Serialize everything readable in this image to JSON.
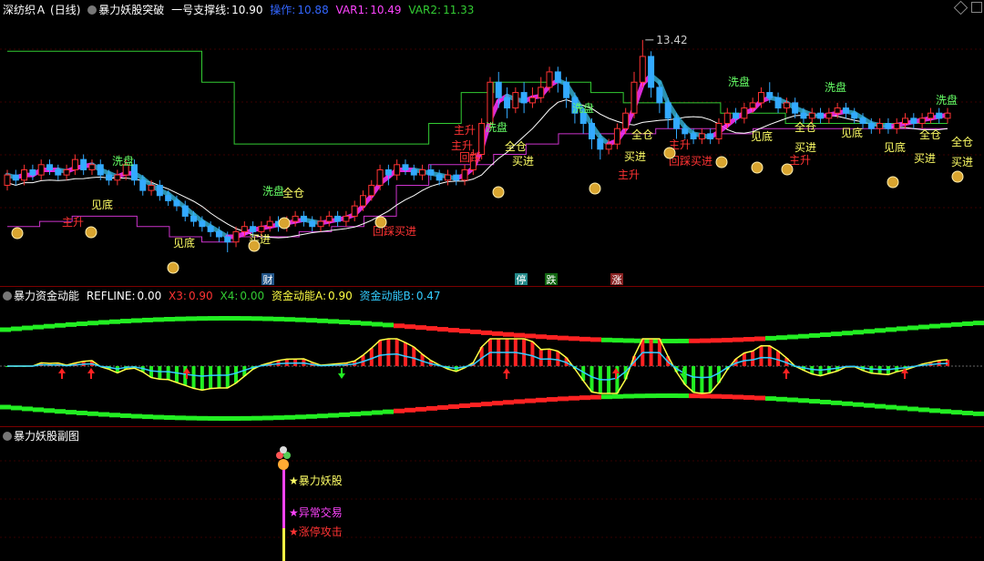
{
  "panel1": {
    "stock_name": "深纺织Ａ",
    "period": "(日线)",
    "indicator_name": "暴力妖股突破",
    "support_label": "一号支撑线:",
    "support_value": "10.90",
    "op_label": "操作:",
    "op_value": "10.88",
    "var1_label": "VAR1:",
    "var1_value": "10.49",
    "var2_label": "VAR2:",
    "var2_value": "11.33",
    "high_marker": "13.42",
    "colors": {
      "up": "#ff3333",
      "down": "#33aaff",
      "support": "#33cc33",
      "ma": "#ffffff",
      "var1": "#cc33cc",
      "ribbon_up": "#ff33ff",
      "ribbon_dn": "#33aacc"
    },
    "signals": [
      {
        "text": "洗盘",
        "color": "#66ff66"
      },
      {
        "text": "见底",
        "color": "#ffff66"
      },
      {
        "text": "主升",
        "color": "#ff3333"
      },
      {
        "text": "见底",
        "color": "#ffff66"
      },
      {
        "text": "买进",
        "color": "#ffff66"
      },
      {
        "text": "洗盘",
        "color": "#66ff66"
      },
      {
        "text": "全仓",
        "color": "#ffff66"
      },
      {
        "text": "主升",
        "color": "#ff3333"
      },
      {
        "text": "回踩买进",
        "color": "#ff3333"
      },
      {
        "text": "主升",
        "color": "#ff3333"
      },
      {
        "text": "回踩",
        "color": "#ff3333"
      },
      {
        "text": "洗盘",
        "color": "#66ff66"
      },
      {
        "text": "全仓",
        "color": "#ffff66"
      },
      {
        "text": "买进",
        "color": "#ffff66"
      },
      {
        "text": "洗盘",
        "color": "#66ff66"
      },
      {
        "text": "全仓",
        "color": "#ffff66"
      },
      {
        "text": "买进",
        "color": "#ffff66"
      },
      {
        "text": "主升",
        "color": "#ff3333"
      },
      {
        "text": "主升",
        "color": "#ff3333"
      },
      {
        "text": "回踩买进",
        "color": "#ff3333"
      },
      {
        "text": "洗盘",
        "color": "#66ff66"
      },
      {
        "text": "见底",
        "color": "#ffff66"
      },
      {
        "text": "全仓",
        "color": "#ffff66"
      },
      {
        "text": "买进",
        "color": "#ffff66"
      },
      {
        "text": "主升",
        "color": "#ff3333"
      },
      {
        "text": "洗盘",
        "color": "#66ff66"
      },
      {
        "text": "见底",
        "color": "#ffff66"
      },
      {
        "text": "见底",
        "color": "#ffff66"
      },
      {
        "text": "买进",
        "color": "#ffff66"
      },
      {
        "text": "洗盘",
        "color": "#66ff66"
      },
      {
        "text": "全仓",
        "color": "#ffff66"
      },
      {
        "text": "全仓",
        "color": "#ffff66"
      },
      {
        "text": "买进",
        "color": "#ffff66"
      }
    ],
    "bottom_tags": [
      {
        "text": "财",
        "bg": "#225588",
        "fg": "#ffffff"
      },
      {
        "text": "停",
        "bg": "#228888",
        "fg": "#ffffff"
      },
      {
        "text": "跌",
        "bg": "#116611",
        "fg": "#ffffff"
      },
      {
        "text": "涨",
        "bg": "#882222",
        "fg": "#ffffff"
      }
    ]
  },
  "panel2": {
    "indicator_name": "暴力资金动能",
    "refline_label": "REFLINE:",
    "refline_value": "0.00",
    "x3_label": "X3:",
    "x3_value": "0.90",
    "x4_label": "X4:",
    "x4_value": "0.00",
    "a_label": "资金动能A:",
    "a_value": "0.90",
    "b_label": "资金动能B:",
    "b_value": "0.47"
  },
  "panel3": {
    "indicator_name": "暴力妖股副图",
    "labels": [
      {
        "text": "暴力妖股",
        "color": "#ffff66"
      },
      {
        "text": "异常交易",
        "color": "#ff44ff"
      },
      {
        "text": "涨停攻击",
        "color": "#ff3333"
      }
    ]
  },
  "chart_data": {
    "type": "candlestick",
    "title": "暴力妖股突破",
    "candles": [
      [
        10.6,
        10.8,
        10.9,
        10.5
      ],
      [
        10.8,
        10.7,
        10.9,
        10.6
      ],
      [
        10.7,
        10.9,
        11.0,
        10.6
      ],
      [
        10.9,
        10.8,
        11.0,
        10.7
      ],
      [
        10.8,
        11.0,
        11.1,
        10.7
      ],
      [
        11.0,
        10.9,
        11.1,
        10.8
      ],
      [
        10.9,
        10.8,
        11.0,
        10.7
      ],
      [
        10.8,
        10.9,
        11.0,
        10.7
      ],
      [
        10.9,
        11.1,
        11.2,
        10.8
      ],
      [
        11.1,
        10.9,
        11.2,
        10.8
      ],
      [
        10.9,
        11.0,
        11.1,
        10.8
      ],
      [
        11.0,
        10.8,
        11.1,
        10.7
      ],
      [
        10.8,
        10.7,
        10.9,
        10.6
      ],
      [
        10.7,
        10.8,
        10.9,
        10.6
      ],
      [
        10.8,
        11.0,
        11.1,
        10.7
      ],
      [
        11.0,
        10.7,
        11.1,
        10.6
      ],
      [
        10.7,
        10.5,
        10.8,
        10.4
      ],
      [
        10.5,
        10.6,
        10.7,
        10.4
      ],
      [
        10.6,
        10.4,
        10.7,
        10.3
      ],
      [
        10.4,
        10.3,
        10.5,
        10.2
      ],
      [
        10.3,
        10.2,
        10.4,
        10.1
      ],
      [
        10.2,
        10.0,
        10.3,
        9.9
      ],
      [
        10.0,
        9.9,
        10.1,
        9.8
      ],
      [
        9.9,
        9.8,
        10.0,
        9.7
      ],
      [
        9.8,
        9.7,
        9.9,
        9.6
      ],
      [
        9.7,
        9.6,
        9.8,
        9.5
      ],
      [
        9.6,
        9.5,
        9.7,
        9.3
      ],
      [
        9.5,
        9.7,
        9.8,
        9.4
      ],
      [
        9.7,
        9.8,
        9.9,
        9.6
      ],
      [
        9.8,
        9.7,
        9.9,
        9.6
      ],
      [
        9.7,
        9.8,
        9.9,
        9.6
      ],
      [
        9.8,
        9.9,
        10.0,
        9.7
      ],
      [
        9.9,
        9.8,
        10.0,
        9.7
      ],
      [
        9.8,
        9.9,
        10.0,
        9.7
      ],
      [
        9.9,
        10.0,
        10.1,
        9.8
      ],
      [
        10.0,
        9.9,
        10.1,
        9.8
      ],
      [
        9.9,
        9.8,
        10.0,
        9.7
      ],
      [
        9.8,
        9.9,
        10.0,
        9.7
      ],
      [
        9.9,
        10.0,
        10.1,
        9.8
      ],
      [
        10.0,
        9.9,
        10.1,
        9.8
      ],
      [
        9.9,
        10.0,
        10.1,
        9.8
      ],
      [
        10.0,
        10.2,
        10.3,
        9.9
      ],
      [
        10.2,
        10.4,
        10.5,
        10.1
      ],
      [
        10.4,
        10.6,
        10.7,
        10.3
      ],
      [
        10.6,
        10.9,
        11.0,
        10.5
      ],
      [
        10.9,
        10.8,
        11.0,
        10.6
      ],
      [
        10.8,
        11.0,
        11.1,
        10.7
      ],
      [
        11.0,
        10.9,
        11.1,
        10.8
      ],
      [
        10.9,
        10.8,
        11.0,
        10.7
      ],
      [
        10.8,
        10.9,
        11.0,
        10.7
      ],
      [
        10.9,
        10.8,
        11.0,
        10.7
      ],
      [
        10.8,
        10.7,
        10.9,
        10.6
      ],
      [
        10.7,
        10.8,
        10.9,
        10.6
      ],
      [
        10.8,
        10.7,
        10.9,
        10.6
      ],
      [
        10.7,
        10.9,
        11.0,
        10.6
      ],
      [
        10.9,
        11.2,
        11.3,
        10.8
      ],
      [
        11.2,
        11.8,
        11.9,
        11.1
      ],
      [
        11.8,
        12.6,
        12.7,
        11.7
      ],
      [
        12.6,
        12.3,
        12.8,
        12.1
      ],
      [
        12.3,
        12.1,
        12.5,
        11.9
      ],
      [
        12.1,
        12.4,
        12.5,
        12.0
      ],
      [
        12.4,
        12.2,
        12.6,
        12.0
      ],
      [
        12.2,
        12.3,
        12.5,
        12.1
      ],
      [
        12.3,
        12.5,
        12.7,
        12.2
      ],
      [
        12.5,
        12.8,
        12.9,
        12.4
      ],
      [
        12.8,
        12.6,
        12.9,
        12.4
      ],
      [
        12.6,
        12.3,
        12.7,
        12.1
      ],
      [
        12.3,
        12.0,
        12.4,
        11.8
      ],
      [
        12.0,
        11.8,
        12.1,
        11.6
      ],
      [
        11.8,
        11.5,
        11.9,
        11.3
      ],
      [
        11.5,
        11.3,
        11.6,
        11.1
      ],
      [
        11.3,
        11.4,
        11.5,
        11.2
      ],
      [
        11.4,
        11.7,
        11.8,
        11.3
      ],
      [
        11.7,
        12.0,
        12.1,
        11.6
      ],
      [
        12.0,
        12.6,
        12.8,
        11.9
      ],
      [
        12.6,
        13.1,
        13.42,
        12.5
      ],
      [
        13.1,
        12.5,
        13.2,
        12.3
      ],
      [
        12.5,
        12.2,
        12.6,
        12.0
      ],
      [
        12.2,
        11.9,
        12.3,
        11.7
      ],
      [
        11.9,
        11.7,
        12.0,
        11.5
      ],
      [
        11.7,
        11.6,
        11.8,
        11.5
      ],
      [
        11.6,
        11.5,
        11.7,
        11.4
      ],
      [
        11.5,
        11.6,
        11.7,
        11.4
      ],
      [
        11.6,
        11.5,
        11.7,
        11.4
      ],
      [
        11.5,
        11.8,
        11.9,
        11.4
      ],
      [
        11.8,
        12.0,
        12.1,
        11.7
      ],
      [
        12.0,
        11.9,
        12.1,
        11.8
      ],
      [
        11.9,
        12.1,
        12.2,
        11.8
      ],
      [
        12.1,
        12.2,
        12.3,
        12.0
      ],
      [
        12.2,
        12.4,
        12.5,
        12.1
      ],
      [
        12.4,
        12.3,
        12.6,
        12.2
      ],
      [
        12.3,
        12.1,
        12.4,
        12.0
      ],
      [
        12.1,
        12.2,
        12.3,
        12.0
      ],
      [
        12.2,
        12.0,
        12.3,
        11.9
      ],
      [
        12.0,
        11.9,
        12.1,
        11.8
      ],
      [
        11.9,
        12.0,
        12.1,
        11.8
      ],
      [
        12.0,
        11.9,
        12.1,
        11.8
      ],
      [
        11.9,
        12.0,
        12.1,
        11.8
      ],
      [
        12.0,
        12.1,
        12.2,
        11.9
      ],
      [
        12.1,
        12.0,
        12.2,
        11.9
      ],
      [
        12.0,
        11.9,
        12.1,
        11.8
      ],
      [
        11.9,
        11.8,
        12.0,
        11.7
      ],
      [
        11.8,
        11.7,
        11.9,
        11.6
      ],
      [
        11.7,
        11.8,
        11.9,
        11.6
      ],
      [
        11.8,
        11.7,
        11.9,
        11.6
      ],
      [
        11.7,
        11.8,
        11.9,
        11.6
      ],
      [
        11.8,
        11.9,
        12.0,
        11.7
      ],
      [
        11.9,
        11.8,
        12.0,
        11.7
      ],
      [
        11.8,
        11.9,
        12.0,
        11.7
      ],
      [
        11.9,
        12.0,
        12.1,
        11.8
      ],
      [
        12.0,
        11.9,
        12.1,
        11.8
      ],
      [
        11.9,
        12.0,
        12.1,
        11.8
      ]
    ],
    "series": [
      {
        "name": "一号支撑线",
        "values": [
          13.2,
          13.2,
          13.2,
          13.2,
          13.2,
          13.2,
          12.6,
          11.4,
          11.4,
          11.4,
          11.4,
          11.4,
          11.4,
          11.8,
          12.4,
          12.6,
          12.6,
          12.6,
          12.4,
          12.2,
          12.2,
          12.2,
          12.0,
          12.0,
          11.8,
          11.8,
          11.8,
          11.8,
          11.8,
          11.8
        ]
      },
      {
        "name": "VAR1",
        "values": [
          9.8,
          9.9,
          10.0,
          10.0,
          9.8,
          9.6,
          9.5,
          9.6,
          9.6,
          9.7,
          9.8,
          10.0,
          10.6,
          11.0,
          11.0,
          11.2,
          11.4,
          11.6,
          11.6,
          11.6,
          11.7,
          11.7,
          11.6,
          11.7,
          11.7,
          11.7,
          11.7,
          11.7,
          11.7,
          11.7
        ]
      }
    ],
    "ylim": [
      9.0,
      13.7
    ]
  }
}
